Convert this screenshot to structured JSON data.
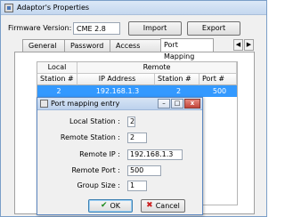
{
  "window": {
    "title": "Adaptor's Properties"
  },
  "firmware": {
    "label": "Firmware Version:",
    "value": "CME 2.8"
  },
  "toolbar": {
    "import_label": "Import",
    "export_label": "Export"
  },
  "tabs": [
    {
      "label": "General"
    },
    {
      "label": "Password"
    },
    {
      "label": "Access Control"
    },
    {
      "label": "Port Mapping",
      "active": true
    }
  ],
  "tab_scroll": {
    "left": "◀",
    "right": "▶"
  },
  "table": {
    "group_local": "Local",
    "group_remote": "Remote",
    "columns": [
      "Station #",
      "IP Address",
      "Station #",
      "Port #"
    ],
    "rows": [
      [
        "2",
        "192.168.1.3",
        "2",
        "500"
      ]
    ],
    "selected_row": 0
  },
  "dialog": {
    "title": "Port mapping entry",
    "fields": [
      {
        "label": "Local Station :",
        "value": "2"
      },
      {
        "label": "Remote Station :",
        "value": "2"
      },
      {
        "label": "Remote  IP :",
        "value": "192.168.1.3"
      },
      {
        "label": "Remote  Port :",
        "value": "500"
      },
      {
        "label": "Group Size :",
        "value": "1"
      }
    ],
    "ok_label": "OK",
    "cancel_label": "Cancel",
    "window_buttons": {
      "minimize": "–",
      "maximize": "□",
      "close": "x"
    }
  },
  "colors": {
    "selection": "#3399ff",
    "close_button": "#c2443a"
  }
}
